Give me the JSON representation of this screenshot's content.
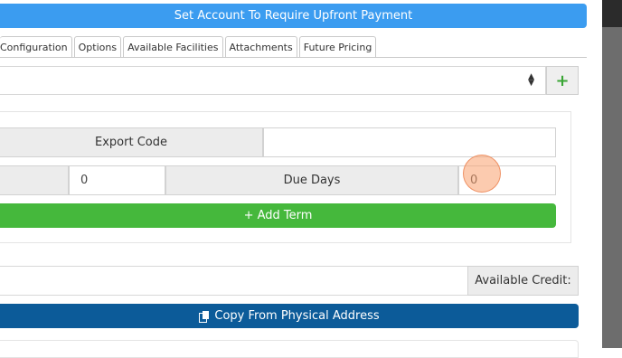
{
  "banner": {
    "label": "Set Account To Require Upfront Payment"
  },
  "tabs": [
    {
      "label": "Configuration"
    },
    {
      "label": "Options"
    },
    {
      "label": "Available Facilities"
    },
    {
      "label": "Attachments"
    },
    {
      "label": "Future Pricing"
    }
  ],
  "select": {
    "value": ""
  },
  "add_button": {
    "label": "+"
  },
  "terms": {
    "export_code_label": "Export Code",
    "export_code_value": "",
    "left_value": "0",
    "due_days_label": "Due Days",
    "due_days_value": "0",
    "add_term_label": "+ Add Term"
  },
  "credit": {
    "value": "",
    "label": "Available Credit:"
  },
  "copy_button": {
    "label": "Copy From Physical Address",
    "icon": "copy-icon"
  },
  "colors": {
    "banner": "#3b9cf0",
    "add_term": "#45b83c",
    "copy_button": "#0c5b99"
  }
}
